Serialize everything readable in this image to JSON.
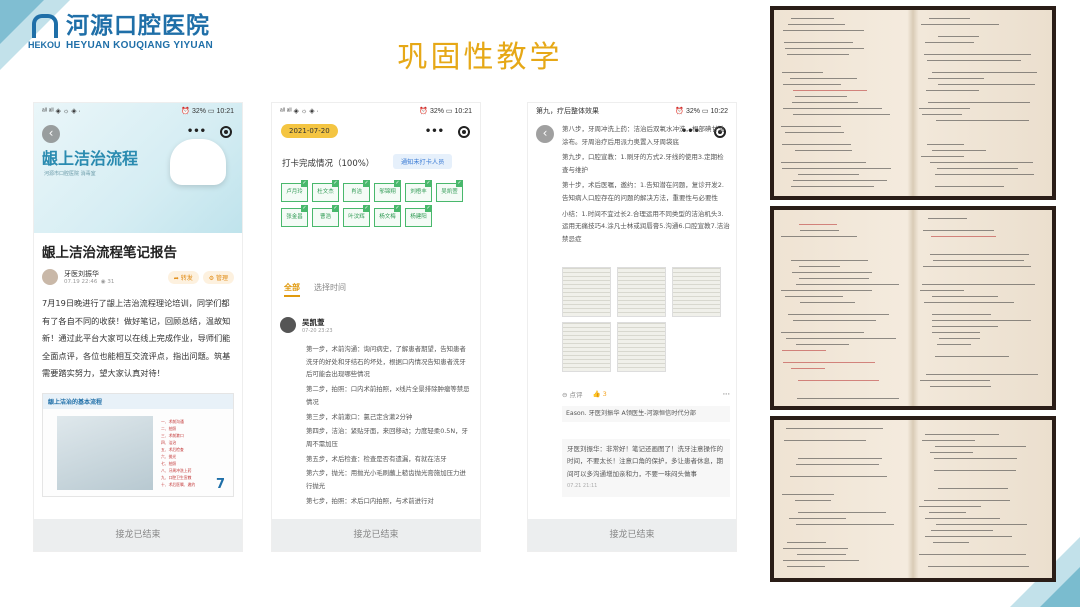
{
  "header": {
    "hospital_cn": "河源口腔医院",
    "hospital_en": "HEYUAN KOUQIANG YIYUAN",
    "logo_mark": "HEKOU",
    "title": "巩固性教学"
  },
  "phone1": {
    "statusbar_left": "ᵃˡˡ ᵃˡˡ ◈ ☼ ◈ ·",
    "statusbar_right": "⏰ 32% ▭ 10:21",
    "hero_title": "龈上洁治流程",
    "hero_sub": "河源市口腔医院  消毒室",
    "article_title": "龈上洁治流程笔记报告",
    "author": "牙医刘振华",
    "time": "07.19 22:46",
    "views": "◉ 31",
    "share": "➦ 转发",
    "manage": "⚙ 管理",
    "body": "7月19日晚进行了龈上洁治流程理论培训，同学们都有了各自不同的收获！做好笔记，回顾总结，温故知新！通过此平台大家可以在线上完成作业，导师们能全面点评，各位也能相互交流评点，指出问题。筑基需要踏实努力，望大家认真对待！",
    "doc_heading": "龈上洁治的基本流程",
    "doc_items": [
      "一、术前沟通",
      "二、拍照",
      "三、术前漱口",
      "四、洁治",
      "五、术后检查",
      "六、抛光",
      "七、拍照",
      "八、牙周冲洗上药",
      "九、口腔卫生宣教",
      "十、术后医嘱、邀约"
    ],
    "doc_page": "7",
    "footer": "接龙已结束"
  },
  "phone2": {
    "statusbar_left": "ᵃˡˡ ᵃˡˡ ◈ ☼ ◈ ·",
    "statusbar_right": "⏰ 32% ▭ 10:21",
    "date": "2021-07-20",
    "status": "打卡完成情况（100%）",
    "notify": "通知未打卡人员",
    "names": [
      "卢月玲",
      "杜文杰",
      "肖洁",
      "邬锦翔",
      "刘梧丰",
      "吴凯萱",
      "张金昌",
      "曹浩",
      "叶汶辉",
      "杨文梅",
      "杨建阳"
    ],
    "tab_all": "全部",
    "tab_time": "选择时间",
    "post_name": "吴凯萱",
    "post_time": "07-20 23:23",
    "steps": [
      "第一步，术前沟通：询问病史，了解患者期望，告知患者洗牙的好处和牙结石的坏处，根据口内情况告知患者洗牙后可能会出现哪些情况",
      "第二步，拍照：口内术前拍照，x线片全景排除肿瘤等禁忌情况",
      "第三步，术前漱口：氯己定含漱2分钟",
      "第四步，洁治：紧贴牙面，来回移动；力度轻柔0.5N，牙周不需加压",
      "第五步，术后检查：检查是否有遗漏，有就在洁牙",
      "第六步，抛光：用抛光小毛刷蘸上糙齿抛光膏施加压力进行抛光",
      "第七步，拍照：术后口内拍照，与术前进行对"
    ],
    "footer": "接龙已结束"
  },
  "phone3": {
    "top_line": "第九，疗后整体效果",
    "statusbar_right": "⏰ 32% ▭ 10:22",
    "paragraphs": [
      "第八步，牙周冲洗上药：洁治后双氧水冲洗，根部碘甘油涂布。牙周治疗后用派力奥置入牙周袋底",
      "第九步，口腔宣教：1.刷牙的方式2.牙线的使用3.定期检查与维护",
      "第十步，术后医嘱，邀约：1.告知潜在问题，复诊开发2.告知病人口腔存在的问题的解决方法，重要性与必要性",
      "小结：1.时间不宜过长2.合理运用不同类型的洁治机头3.运用无痛技巧4.涂凡士林或润唇膏5.沟通6.口腔宣教7.洁治禁忌症"
    ],
    "comment_label": "⊖ 点评",
    "likes": "👍 3",
    "more": "···",
    "like_names": "Eason.  牙医刘振华  A领医生-河源恒信时代分部",
    "reply": "牙医刘振华：非常好！笔记还画图了！洗牙注意操作的时间，不要太长！注意口角的保护，多让患者休息，期间可以多沟通增加亲和力，不要一味闷头做事",
    "reply_time": "07.21 21:11",
    "footer": "接龙已结束"
  },
  "colors": {
    "brand": "#1f6fa8",
    "title_gold": "#e6a817",
    "check_green": "#49b86c",
    "accent_orange": "#e09a0f"
  }
}
